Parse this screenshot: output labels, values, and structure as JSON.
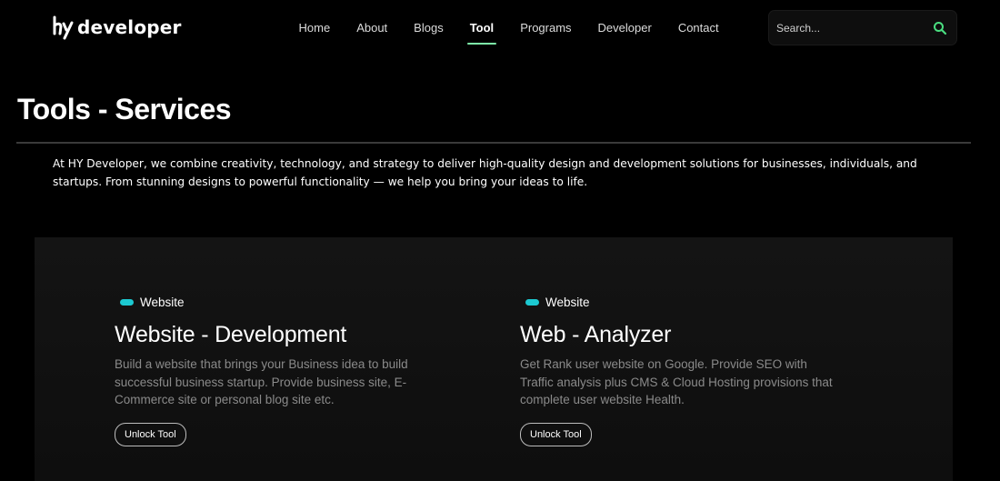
{
  "brand": {
    "name": "developer",
    "logo_icon": "hy-logo-mark"
  },
  "nav": {
    "items": [
      {
        "label": "Home",
        "active": false
      },
      {
        "label": "About",
        "active": false
      },
      {
        "label": "Blogs",
        "active": false
      },
      {
        "label": "Tool",
        "active": true
      },
      {
        "label": "Programs",
        "active": false
      },
      {
        "label": "Developer",
        "active": false
      },
      {
        "label": "Contact",
        "active": false
      }
    ],
    "active_underline_color": "#7df0a8"
  },
  "search": {
    "placeholder": "Search...",
    "value": "",
    "icon": "search-icon",
    "icon_color": "#4ade80"
  },
  "header": {
    "title": "Tools - Services",
    "intro": "At HY Developer, we combine creativity, technology, and strategy to deliver high-quality design and development solutions for businesses, individuals, and startups. From stunning designs to powerful functionality — we help you bring your ideas to life."
  },
  "tools": [
    {
      "badge": "Website",
      "title": "Website - Development",
      "description": "Build a website that brings your Business idea to build successful business startup. Provide business site, E-Commerce site or personal blog site etc.",
      "button": "Unlock Tool"
    },
    {
      "badge": "Website",
      "title": "Web - Analyzer",
      "description": "Get Rank user website on Google. Provide SEO with Traffic analysis plus CMS & Cloud Hosting provisions that complete user website Health.",
      "button": "Unlock Tool"
    }
  ],
  "colors": {
    "background": "#000000",
    "panel": "#141414",
    "badge_accent": "#1cc9d1",
    "muted_text": "#8a8a8a"
  }
}
